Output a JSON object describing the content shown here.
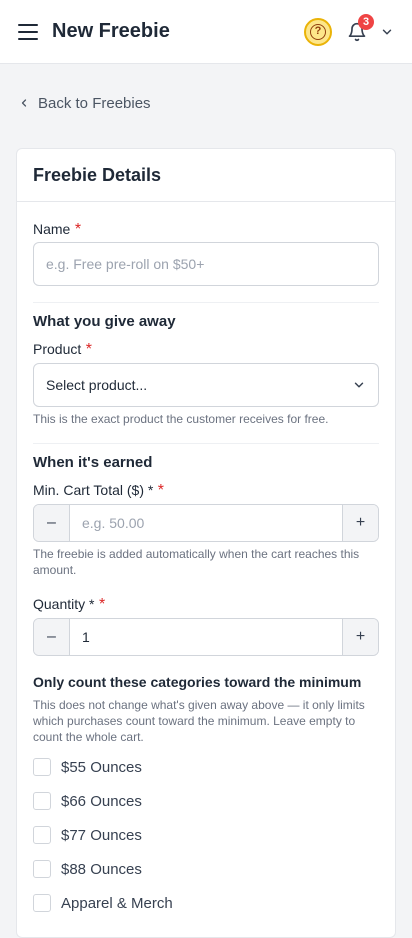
{
  "header": {
    "title": "New Freebie",
    "notification_count": "3",
    "help_glyph": "?"
  },
  "back_link": {
    "label": "Back to Freebies"
  },
  "card": {
    "title": "Freebie Details",
    "name_field": {
      "label": "Name",
      "required_mark": "*",
      "placeholder": "e.g. Free pre-roll on $50+"
    },
    "give_away": {
      "section_title": "What you give away",
      "product_label": "Product",
      "required_mark": "*",
      "product_value": "Select product...",
      "help": "This is the exact product the customer receives for free."
    },
    "earned": {
      "section_title": "When it's earned",
      "min_cart_label": "Min. Cart Total ($) *",
      "required_mark": "*",
      "min_cart_placeholder": "e.g. 50.00",
      "min_cart_help": "The freebie is added automatically when the cart reaches this amount.",
      "quantity_label": "Quantity *",
      "quantity_value": "1",
      "minus": "–",
      "plus": "+"
    },
    "categories": {
      "section_title": "Only count these categories toward the minimum",
      "help": "This does not change what's given away above — it only limits which purchases count toward the minimum. Leave empty to count the whole cart.",
      "items": [
        {
          "label": "$55 Ounces"
        },
        {
          "label": "$66 Ounces"
        },
        {
          "label": "$77 Ounces"
        },
        {
          "label": "$88 Ounces"
        },
        {
          "label": "Apparel & Merch"
        }
      ]
    }
  },
  "colors": {
    "accent_yellow": "#eab308",
    "required_red": "#dc2626",
    "badge_red": "#ef4444"
  }
}
